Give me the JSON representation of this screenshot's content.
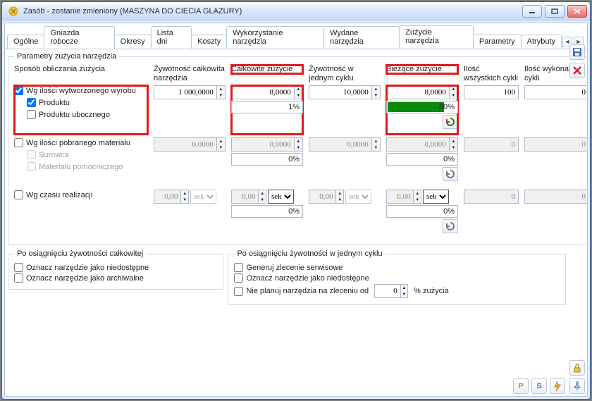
{
  "window": {
    "title": "Zasób - zostanie zmieniony  (MASZYNA DO CIECIA GLAZURY)"
  },
  "tabs": {
    "items": [
      "Ogólne",
      "Gniazda robocze",
      "Okresy",
      "Lista dni",
      "Koszty",
      "Wykorzystanie narzędzia",
      "Wydane narzędzia",
      "Zużycie narzędzia",
      "Parametry",
      "Atrybuty"
    ],
    "active_index": 7
  },
  "group": {
    "legend": "Parametry zużycia narzędzia"
  },
  "headers": {
    "method": "Sposób obliczania zużycia",
    "life_total": "Żywotność całkowita narzędzia",
    "wear_total": "Całkowite zużycie",
    "life_cycle": "Żywotność w jednym cyklu",
    "wear_current": "Bieżące zużycie",
    "cycles_all": "Ilość wszystkich cykli",
    "cycles_done": "Ilość wykonanych cykli"
  },
  "row_qty": {
    "label": "Wg ilości wytworzonego wyrobu",
    "checked": true,
    "sub1": "Produktu",
    "sub1_checked": true,
    "sub2": "Produktu ubocznego",
    "sub2_checked": false,
    "life_total": "1 000,0000",
    "wear_total": "8,0000",
    "wear_total_pct": "1%",
    "life_cycle": "10,0000",
    "wear_current": "8,0000",
    "wear_current_pct": "80%",
    "cycles_all": "100",
    "cycles_done": "0"
  },
  "row_mat": {
    "label": "Wg ilości pobranego materiału",
    "checked": false,
    "sub1": "Surowca",
    "sub2": "Materiału pomocniczego",
    "zero4": "0,0000",
    "pct": "0%",
    "zero": "0"
  },
  "row_time": {
    "label": "Wg czasu realizacji",
    "checked": false,
    "val": "0,00",
    "unit": "sek",
    "pct": "0%",
    "zero": "0"
  },
  "total_life": {
    "legend": "Po osiągnięciu żywotności całkowitej",
    "opt1": "Oznacz narzędzie jako niedostępne",
    "opt2": "Oznacz narzędzie jako archiwalne"
  },
  "cycle_life": {
    "legend": "Po osiągnięciu żywotności w jednym cyklu",
    "opt1": "Generuj zlecenie serwisowe",
    "opt2": "Oznacz narzędzie jako niedostępne",
    "opt3": "Nie planuj narzędzia na zleceniu od",
    "opt3_val": "0",
    "opt3_suffix": "% zużycia"
  },
  "colors": {
    "progress": "#0a8a0a",
    "highlight": "#e21919"
  }
}
